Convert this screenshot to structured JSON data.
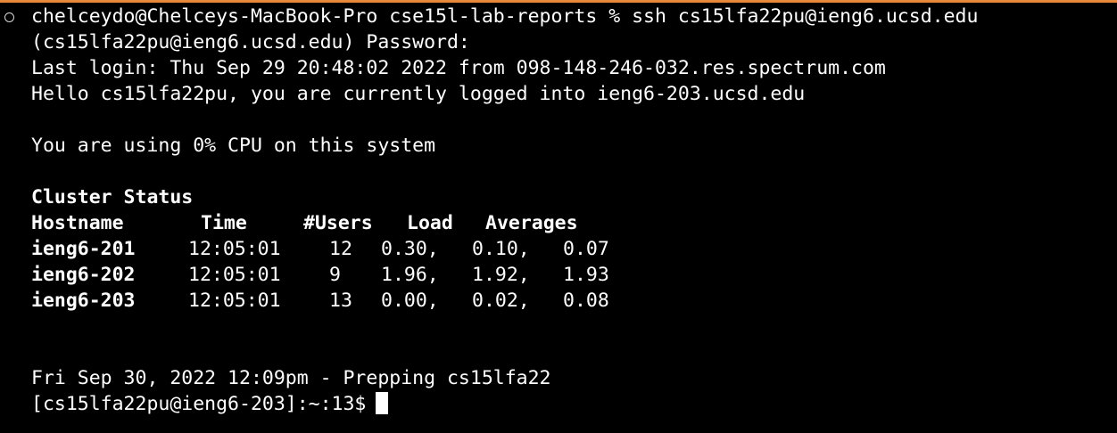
{
  "theme": {
    "background": "#000000",
    "foreground": "#ffffff",
    "border_accent": "#e88a3c"
  },
  "terminal": {
    "command_line": "chelceydo@Chelceys-MacBook-Pro cse15l-lab-reports % ssh cs15lfa22pu@ieng6.ucsd.edu",
    "password_prompt": "(cs15lfa22pu@ieng6.ucsd.edu) Password:",
    "last_login": "Last login: Thu Sep 29 20:48:02 2022 from 098-148-246-032.res.spectrum.com",
    "hello": "Hello cs15lfa22pu, you are currently logged into ieng6-203.ucsd.edu",
    "cpu": "You are using 0% CPU on this system",
    "cluster_title": "Cluster Status",
    "headers": {
      "hostname": "Hostname",
      "time": "Time",
      "users": "#Users",
      "load": "Load",
      "averages": "Averages"
    },
    "rows": [
      {
        "host": "ieng6-201",
        "time": "12:05:01",
        "users": "12",
        "l1": "0.30,",
        "l2": "0.10,",
        "l3": "0.07"
      },
      {
        "host": "ieng6-202",
        "time": "12:05:01",
        "users": "9",
        "l1": "1.96,",
        "l2": "1.92,",
        "l3": "1.93"
      },
      {
        "host": "ieng6-203",
        "time": "12:05:01",
        "users": "13",
        "l1": "0.00,",
        "l2": "0.02,",
        "l3": "0.08"
      }
    ],
    "motd": "Fri Sep 30, 2022 12:09pm - Prepping cs15lfa22",
    "prompt": "[cs15lfa22pu@ieng6-203]:~:13$"
  }
}
